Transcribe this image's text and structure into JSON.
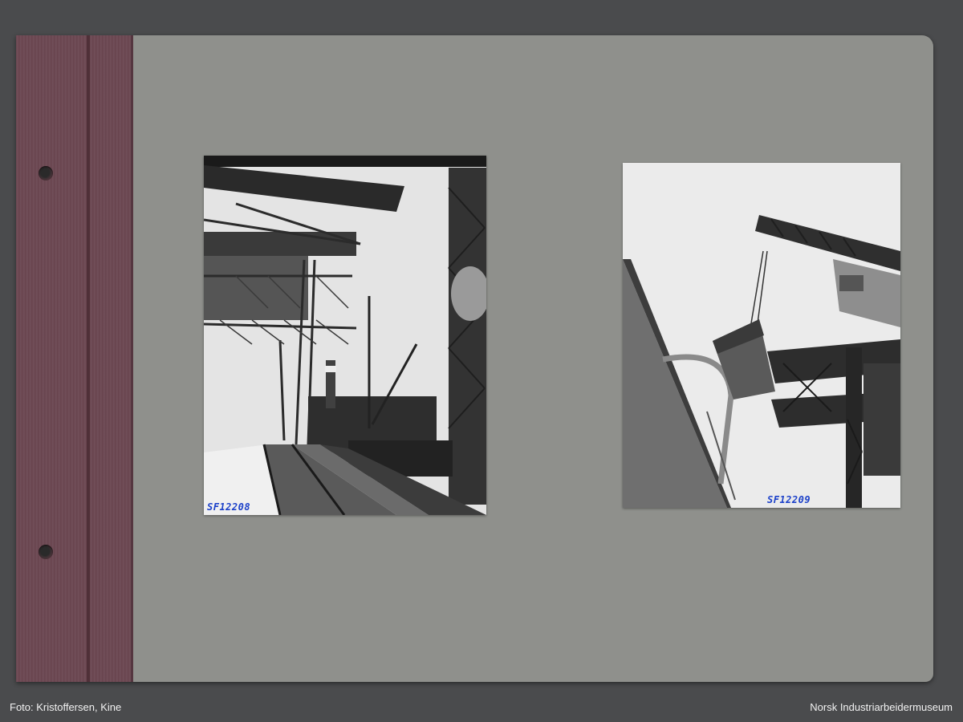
{
  "photos": [
    {
      "negative_number": "SF12208"
    },
    {
      "negative_number": "SF12209"
    }
  ],
  "caption": {
    "photographer": "Foto: Kristoffersen, Kine",
    "institution": "Norsk Industriarbeidermuseum"
  },
  "colors": {
    "background": "#4a4b4d",
    "page": "#8f908c",
    "spine": "#6a4550",
    "label_ink": "#1b40c9"
  }
}
